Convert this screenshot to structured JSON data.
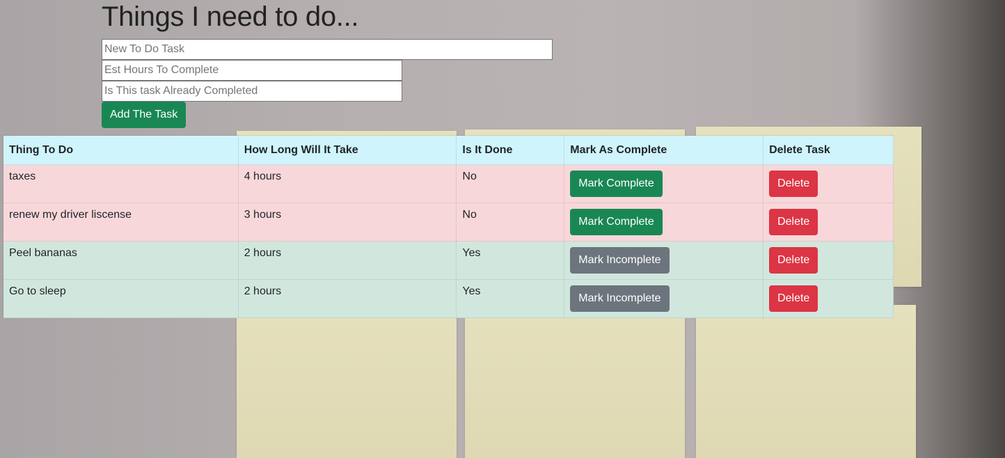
{
  "title": "Things I need to do...",
  "form": {
    "task_placeholder": "New To Do Task",
    "hours_placeholder": "Est Hours To Complete",
    "completed_placeholder": "Is This task Already Completed",
    "add_label": "Add The Task"
  },
  "table": {
    "headers": [
      "Thing To Do",
      "How Long Will It Take",
      "Is It Done",
      "Mark As Complete",
      "Delete Task"
    ],
    "rows": [
      {
        "task": "taxes",
        "hours": "4 hours",
        "done": "No",
        "toggle_label": "Mark Complete",
        "delete_label": "Delete"
      },
      {
        "task": "renew my driver liscense",
        "hours": "3 hours",
        "done": "No",
        "toggle_label": "Mark Complete",
        "delete_label": "Delete"
      },
      {
        "task": "Peel bananas",
        "hours": "2 hours",
        "done": "Yes",
        "toggle_label": "Mark Incomplete",
        "delete_label": "Delete"
      },
      {
        "task": "Go to sleep",
        "hours": "2 hours",
        "done": "Yes",
        "toggle_label": "Mark Incomplete",
        "delete_label": "Delete"
      }
    ]
  },
  "colors": {
    "success": "#198754",
    "secondary": "#6c757d",
    "danger": "#dc3545",
    "header_bg": "#cff4fc",
    "row_incomplete_bg": "#f8d7da",
    "row_complete_bg": "#d1e7dd"
  }
}
